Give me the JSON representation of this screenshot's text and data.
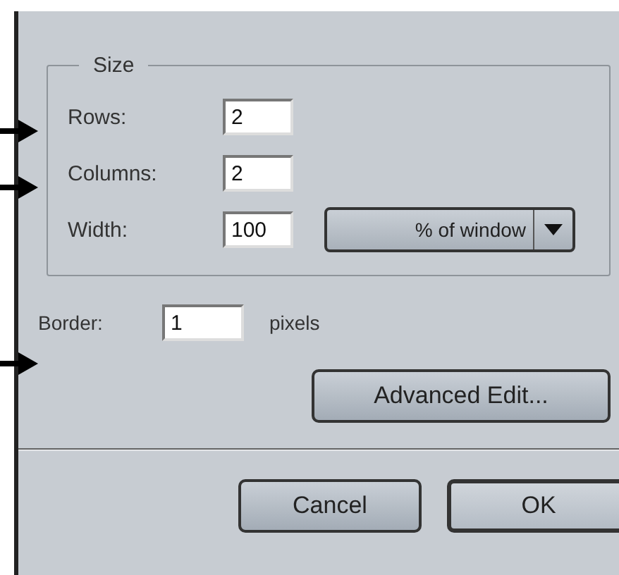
{
  "size_group": {
    "title": "Size",
    "fields": [
      {
        "label": "Rows:",
        "value": "2"
      },
      {
        "label": "Columns:",
        "value": "2"
      },
      {
        "label": "Width:",
        "value": "100"
      }
    ],
    "unit_dropdown": {
      "value": "% of window"
    }
  },
  "border": {
    "label": "Border:",
    "value": "1",
    "unit": "pixels"
  },
  "advanced_button": "Advanced Edit...",
  "buttons": [
    {
      "label": "Cancel",
      "default": false
    },
    {
      "label": "OK",
      "default": true
    }
  ]
}
